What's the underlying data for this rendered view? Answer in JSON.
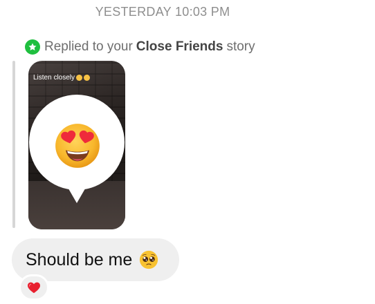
{
  "timestamp": "YESTERDAY 10:03 PM",
  "reply_notice": {
    "prefix": "Replied to your",
    "audience": "Close Friends",
    "suffix": "story",
    "badge_icon": "star-icon",
    "badge_color": "#1fbf3f"
  },
  "story": {
    "caption": "Listen closely",
    "caption_emojis": [
      "smiling-face-emoji",
      "smiling-face-emoji"
    ],
    "reaction_icon": "heart-eyes-emoji"
  },
  "message": {
    "text": "Should be me",
    "emoji_icon": "pleading-face-emoji",
    "reaction_icon": "red-heart-icon"
  },
  "colors": {
    "bubble_gray": "#efefef",
    "timestamp_gray": "#8e8e8e",
    "heart_red": "#e8202f"
  }
}
